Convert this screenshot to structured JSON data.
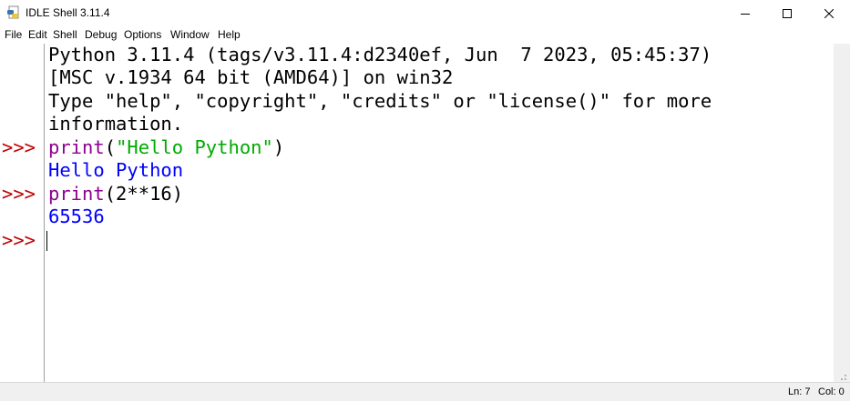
{
  "window": {
    "title": "IDLE Shell 3.11.4",
    "icon": "python-idle-icon",
    "controls": [
      "minimize-icon",
      "maximize-icon",
      "close-icon"
    ]
  },
  "menubar": {
    "items": [
      {
        "label": "File"
      },
      {
        "label": "Edit"
      },
      {
        "label": "Shell"
      },
      {
        "label": "Debug"
      },
      {
        "label": "Options"
      },
      {
        "label": "Window"
      },
      {
        "label": "Help"
      }
    ]
  },
  "shell": {
    "prompt": ">>>",
    "banner": [
      "Python 3.11.4 (tags/v3.11.4:d2340ef, Jun  7 2023, 05:45:37)",
      "[MSC v.1934 64 bit (AMD64)] on win32",
      "Type \"help\", \"copyright\", \"credits\" or \"license()\" for more",
      "information."
    ],
    "commands": [
      {
        "builtin": "print",
        "open": "(",
        "string": "\"Hello Python\"",
        "close": ")",
        "output": "Hello Python"
      },
      {
        "builtin": "print",
        "args": "(2**16)",
        "output": "65536"
      }
    ]
  },
  "colors": {
    "prompt": "#c00000",
    "builtin": "#900090",
    "string": "#00aa00",
    "stdout": "#0000ff",
    "text": "#000000"
  },
  "statusbar": {
    "line": "Ln: 7",
    "col": "Col: 0"
  }
}
